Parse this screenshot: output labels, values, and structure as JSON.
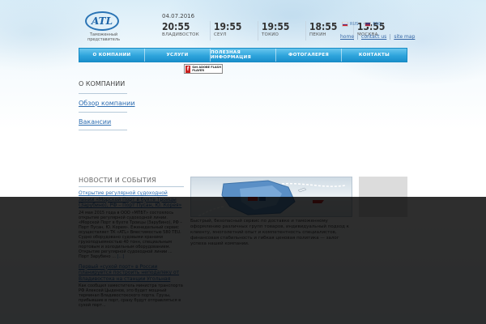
{
  "logo": {
    "text": "ATL",
    "subtitle": "Таможенный представитель"
  },
  "date": "04.07.2016",
  "clocks": [
    {
      "time": "20:55",
      "city": "ВЛАДИВОСТОК"
    },
    {
      "time": "19:55",
      "city": "СЕУЛ"
    },
    {
      "time": "19:55",
      "city": "ТОКИО"
    },
    {
      "time": "18:55",
      "city": "ПЕКИН"
    },
    {
      "time": "13:55",
      "city": "МОСКВА"
    }
  ],
  "languages": [
    {
      "label": "RUS"
    },
    {
      "label": "ENG"
    }
  ],
  "top_links": {
    "home": "home",
    "contact": "contact us",
    "sitemap": "site map"
  },
  "nav": [
    "О КОМПАНИИ",
    "УСЛУГИ",
    "ПОЛЕЗНАЯ ИНФОРМАЦИЯ",
    "ФОТОГАЛЕРЕЯ",
    "КОНТАКТЫ"
  ],
  "flash_badge": {
    "icon": "f",
    "text": "Get ADOBE FLASH PLAYER"
  },
  "sidebar": {
    "title": "О КОМПАНИИ",
    "links": [
      "Обзор компании",
      "Вакансии"
    ]
  },
  "news": {
    "title": "НОВОСТИ И СОБЫТИЯ",
    "items": [
      {
        "headline": "Открытие регулярной судоходной линии «Морской Порт в бухте Троицы (Зарубино), РФ – Порт Пусан, Ю. Корея»",
        "body": "24 мая 2015 года в ООО «МПБТ» состоялось открытие регулярной судоходной линии. «Морской Порт в бухте Троицы (Зарубино), РФ – Порт Пусан, Ю. Корея». Еженедельный сервис осуществляет ТК «ATL» Вместимостью 580 TEU. Судно оборудовано судовыми кранами грузоподъемностью 40 тонн, специальным портовым и холодильным оборудованием. Открытие регулярной судоходной линии ... Порт Зарубино ... ",
        "more": "[...]"
      },
      {
        "headline": "Первый «сухой порт» в России планируется построить неподалеку от Владивостока на станции Угольная",
        "body": "Как сообщил заместитель министра транспорта РФ Алексей Цыденов, это будет мощный терминал Владивостокского порта. Грузы, прибывшие в порт, сразу будут отправляться в сухой порт..."
      }
    ]
  },
  "caption": "Быстрый, безопасный сервис по доставке и таможенному оформлению различных групп товаров, индивидуальный подход к клиенту, многолетний опыт и компетентность специалистов, финансовая стабильность и гибкая ценовая политика — залог успеха нашей компании."
}
